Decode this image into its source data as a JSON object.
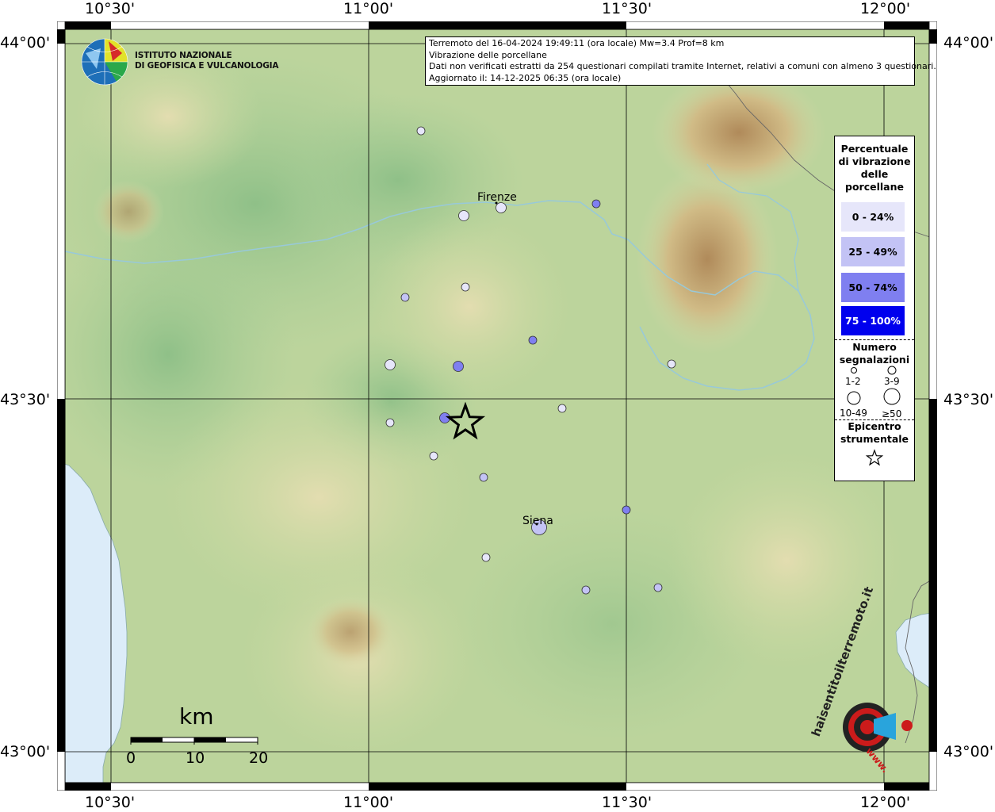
{
  "header": {
    "line1": "Terremoto del 16-04-2024 19:49:11 (ora locale) Mw=3.4 Prof=8 km",
    "line2": "Vibrazione delle porcellane",
    "line3": "Dati non verificati estratti da 254 questionari compilati tramite Internet, relativi a comuni con almeno 3 questionari.",
    "line4": "Aggiornato il: 14-12-2025 06:35 (ora locale)"
  },
  "logo": {
    "line1": "ISTITUTO NAZIONALE",
    "line2": "DI GEOFISICA E VULCANOLOGIA"
  },
  "axes": {
    "top": [
      "10°30'",
      "11°00'",
      "11°30'",
      "12°00'"
    ],
    "bottom": [
      "10°30'",
      "11°00'",
      "11°30'",
      "12°00'"
    ],
    "left": [
      "44°00'",
      "43°30'",
      "43°00'"
    ],
    "right": [
      "44°00'",
      "43°30'",
      "43°00'"
    ]
  },
  "cities": {
    "firenze": "Firenze",
    "siena": "Siena"
  },
  "legend": {
    "title_line1": "Percentuale",
    "title_line2": "di vibrazione",
    "title_line3": "delle",
    "title_line4": "porcellane",
    "classes": [
      {
        "label": "0 - 24%",
        "color": "#e6e6fa",
        "text_color": "#000000"
      },
      {
        "label": "25 - 49%",
        "color": "#c3c3f5",
        "text_color": "#000000"
      },
      {
        "label": "50 - 74%",
        "color": "#7f7ff0",
        "text_color": "#000000"
      },
      {
        "label": "75 - 100%",
        "color": "#0000ee",
        "text_color": "#ffffff"
      }
    ],
    "count_title_line1": "Numero",
    "count_title_line2": "segnalazioni",
    "sizes": [
      "1-2",
      "3-9",
      "10-49",
      "≥50"
    ],
    "epicenter_line1": "Epicentro",
    "epicenter_line2": "strumentale"
  },
  "scalebar": {
    "unit": "km",
    "ticks": [
      "0",
      "10",
      "20"
    ]
  },
  "watermark": {
    "text": "haisentitoilterremoto.it",
    "url": "www."
  },
  "colors": {
    "sea": "#dcecf9",
    "plain": "#a8cf9a",
    "hills": "#cbd9a4",
    "mountains": "#b89a6a"
  }
}
